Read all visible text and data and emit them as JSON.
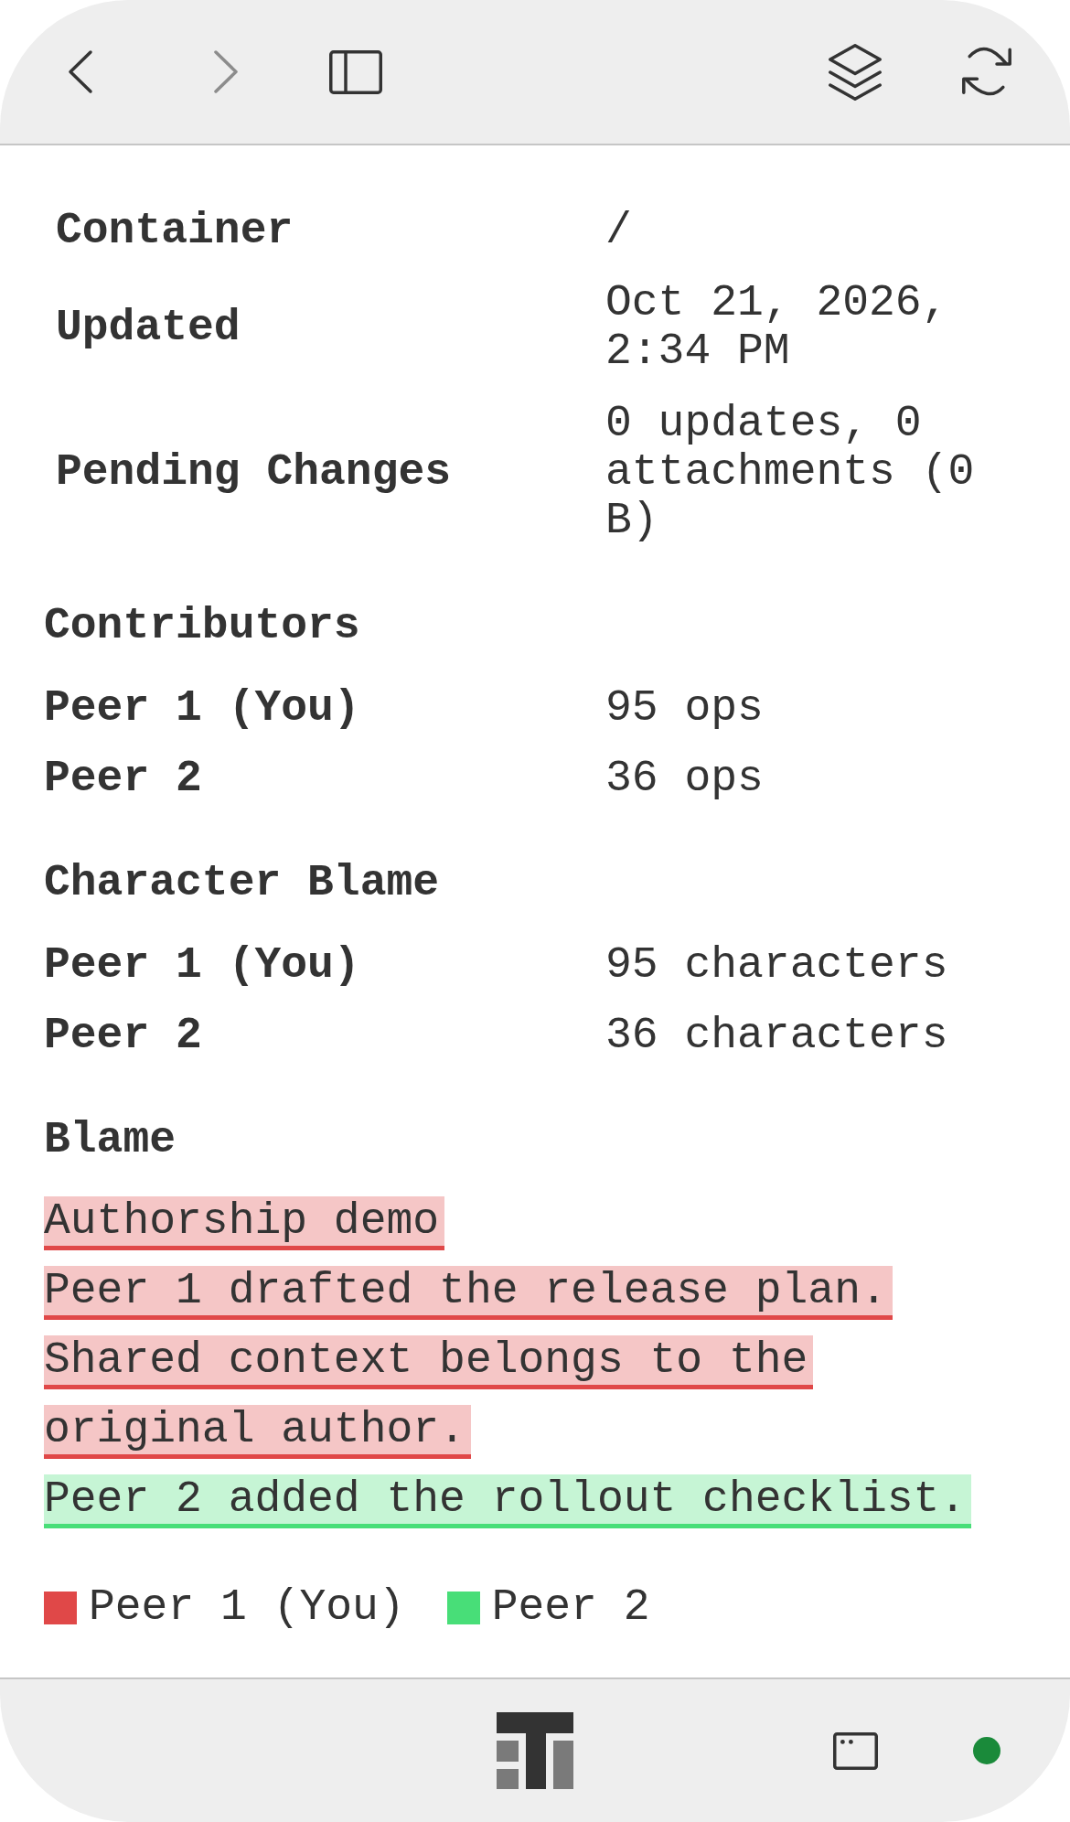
{
  "toolbar": {
    "buttons": [
      {
        "kind": "back",
        "disabled": false
      },
      {
        "kind": "forward",
        "disabled": true
      },
      {
        "kind": "sidebar",
        "disabled": false
      },
      {
        "kind": "layers",
        "disabled": false
      },
      {
        "kind": "refresh",
        "disabled": false
      }
    ]
  },
  "details": [
    {
      "label": "Container",
      "value": "/"
    },
    {
      "label": "Updated",
      "value": "Oct 21, 2026, 2:34 PM"
    },
    {
      "label": "Pending Changes",
      "value": "0 updates, 0 attachments (0 B)"
    }
  ],
  "contributors": {
    "title": "Contributors",
    "rows": [
      {
        "name": "Peer 1 (You)",
        "value": "95 ops"
      },
      {
        "name": "Peer 2",
        "value": "36 ops"
      }
    ]
  },
  "character_blame": {
    "title": "Character Blame",
    "rows": [
      {
        "name": "Peer 1 (You)",
        "value": "95 characters"
      },
      {
        "name": "Peer 2",
        "value": "36 characters"
      }
    ]
  },
  "blame": {
    "title": "Blame",
    "lines": [
      {
        "text": "Authorship demo",
        "color": "#e04848"
      },
      {
        "text": "Peer 1 drafted the release plan.",
        "color": "#e04848"
      },
      {
        "text": "Shared context belongs to the",
        "color": "#e04848"
      },
      {
        "text": "original author.",
        "color": "#e04848"
      },
      {
        "text": "Peer 2 added the rollout checklist.",
        "color": "#48de78"
      }
    ],
    "legend": [
      {
        "label": "Peer 1 (You)",
        "color": "#e04848"
      },
      {
        "label": "Peer 2",
        "color": "#48de78"
      }
    ]
  },
  "bottom_bar": {
    "connected": true
  }
}
